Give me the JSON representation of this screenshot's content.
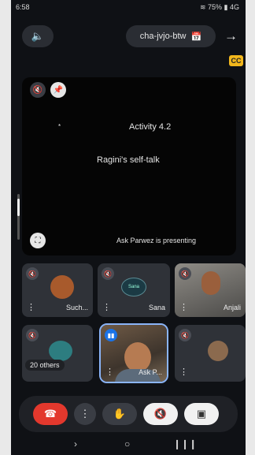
{
  "status": {
    "time": "6:58",
    "right": "≋ 75% ▮ 4G"
  },
  "topbar": {
    "meeting_code": "cha-jvjo-btw"
  },
  "cc_badge": "CC",
  "presentation": {
    "activity": "Activity 4.2",
    "line": "Ragini's self-talk",
    "presenter": "Ask Parwez is presenting",
    "mark": "*"
  },
  "tiles": [
    {
      "name": "Such..."
    },
    {
      "name": "Sana",
      "avatar_text": "Sana"
    },
    {
      "name": "Anjali"
    },
    {
      "name": "20 others"
    },
    {
      "name": "Ask P..."
    },
    {
      "name": ""
    }
  ]
}
